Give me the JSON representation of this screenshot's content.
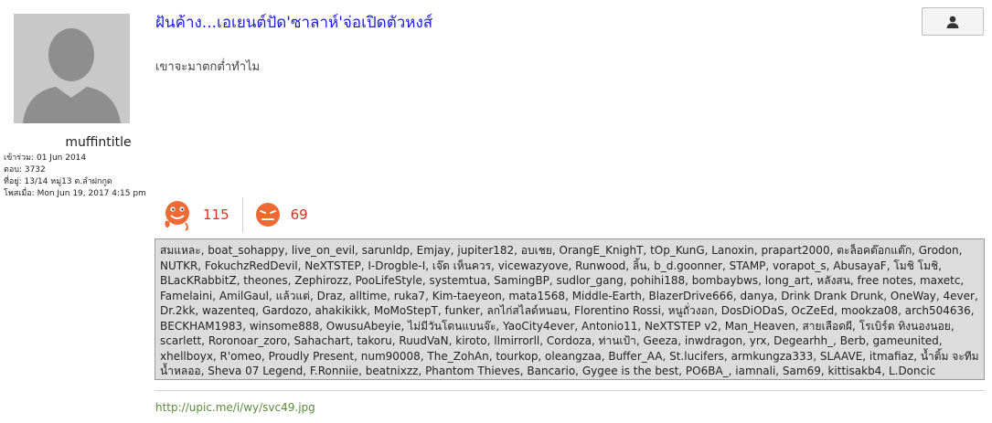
{
  "user": {
    "name": "muffintitle",
    "info": [
      "เข้าร่วม: 01 Jun 2014",
      "ตอบ: 3732",
      "ที่อยู่: 13/14 หมู่13 ต.ลำฝกกูด",
      "โพสเมื่อ: Mon Jun 19, 2017 4:15 pm"
    ]
  },
  "post": {
    "title": "ฝันค้าง...เอเยนต์ปัด'ซาลาห์'จ่อเปิดตัวหงส์",
    "body": "เขาจะมาตกต่ำทำไม",
    "link": "http://upic.me/i/wy/svc49.jpg"
  },
  "reactions": {
    "like_count": "115",
    "dislike_count": "69"
  },
  "reactors_text": "สมแหละ, boat_sohappy, live_on_evil, sarunldp, Emjay, jupiter182, อบเชย, OrangE_KnighT, tOp_KunG, Lanoxin, prapart2000, ตะล็อคต๊อกแต๊ก, Grodon, NUTKR, FokuchzRedDevil, NeXTSTEP, I-Drogble-I, เจ๊ด เห็นควร, vicewazyove, Runwood, ลิ้น, b_d.goonner, STAMP, vorapot_s, AbusayaF, โมชิ โมชิ, BLacKRabbitZ, theones, Zephirozz, PooLifeStyle, systemtua, SamingBP, sudlor_gang, pohihi188, bombaybws, long_art, หลังสน, free notes, maxetc, Famelaini, AmilGaul, แล้วแต่, Draz, alltime, ruka7, Kim-taeyeon, mata1568, Middle-Earth, BlazerDrive666, danya, Drink Drank Drunk, OneWay, 4ever, Dr.2kk, wazenteq, Gardozo, ahakikikk, MoMoStepT, funker, ลกไก่สไลด์หนอน, Florentino Rossi, หนูถั่วงอก, DosDiODaS, OcZeEd, mookza08, arch504636, BECKHAM1983, winsome888, OwusuAbeyie, ไม่มีวันโดนแบนจ๊ะ, YaoCity4ever, Antonio11, NeXTSTEP v2, Man_Heaven, สายเลือดผี, โรเบิร์ต ทิงนองนอย, scarlett, Roronoar_zoro, Sahachart, takoru, RuudVaN, kiroto, llmirrorll, Cordoza, ท่านเป้า, Geeza, inwdragon, yrx, Degearhh_, Berb, gameunited, xhellboyx, R'omeo, Proudly Present, num90008, The_ZohAn, tourkop, oleangzaa, Buffer_AA, St.lucifers, armkungza333, SLAAVE, itmafiaz, น้ำติ้ม จะทีมน้ำหลออ, Sheva 07 Legend, F.Ronniie, beatnixzz, Phantom Thieves, Bancario, Gygee is the best, PO6BA_, iamnali, Sam69, kittisakb4, L.Doncic",
  "icons": {
    "avatar": "default-user-avatar",
    "profile": "user-icon",
    "like": "happy-face-icon",
    "dislike": "angry-face-icon"
  },
  "colors": {
    "title": "#1a1adb",
    "count": "#d9301e",
    "link": "#5a8a3a",
    "reactor_bg": "#dcdcdc"
  }
}
